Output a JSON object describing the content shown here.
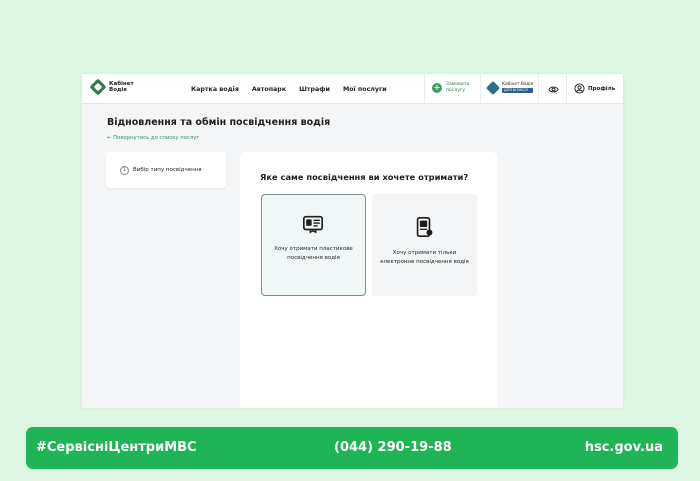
{
  "header": {
    "logo_text": "Кабінет Водія",
    "nav": [
      "Картка водія",
      "Автопарк",
      "Штрафи",
      "Мої послуги"
    ],
    "apply_label": "Замовити послугу",
    "business_label": "Кабінет Водія",
    "business_badge": "ДЛЯ БІЗНЕСУ",
    "profile_label": "Профіль"
  },
  "page": {
    "title": "Відновлення та обмін посвідчення водія",
    "back_link": "← Повернутись до списку послуг"
  },
  "steps": [
    {
      "number": "1",
      "label": "Вибір типу посвідчення"
    }
  ],
  "card": {
    "question": "Яке саме посвідчення ви хочете отримати?",
    "options": [
      {
        "label": "Хочу отримати пластикове посвідчення водія",
        "icon": "plastic-license-icon",
        "selected": true
      },
      {
        "label": "Хочу отримати тільки електронне посвідчення водія",
        "icon": "phone-license-icon",
        "selected": false
      }
    ]
  },
  "footer": {
    "hashtag": "#СервісніЦентриМВС",
    "phone": "(044) 290-19-88",
    "site": "hsc.gov.ua"
  },
  "colors": {
    "background": "#ddf7e2",
    "brand_green": "#2f7a4f",
    "footer_green": "#1fb455",
    "selected_border": "#7e8c8c"
  }
}
